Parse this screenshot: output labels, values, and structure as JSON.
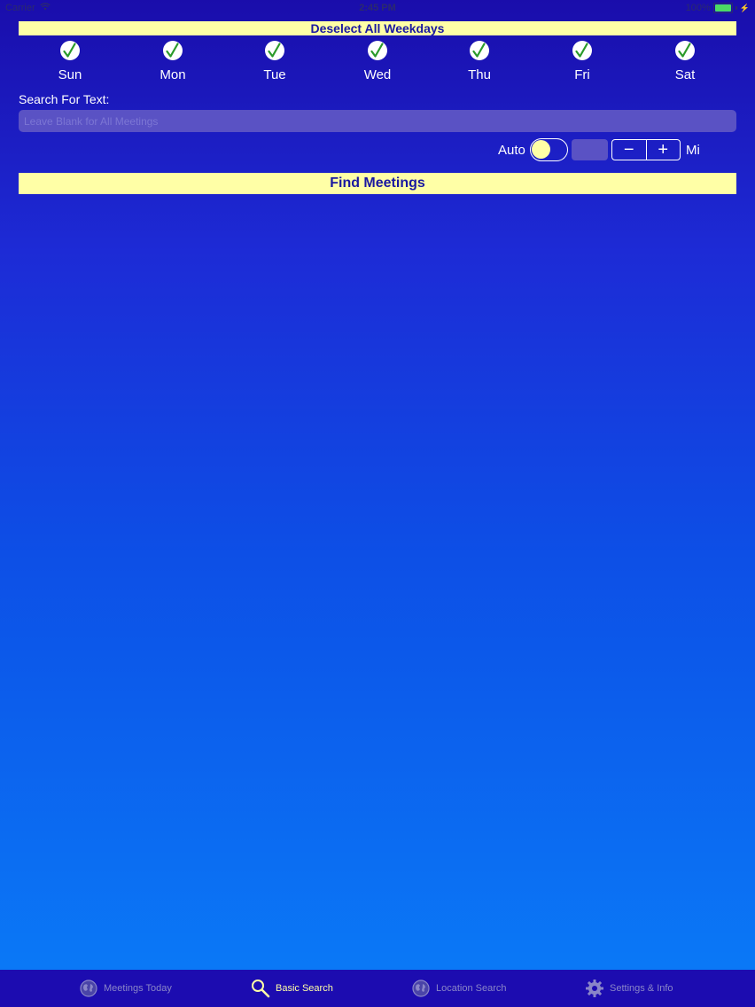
{
  "status_bar": {
    "carrier": "Carrier",
    "time": "2:45 PM",
    "battery": "100%",
    "battery_level": 1.0
  },
  "deselect_button": {
    "label": "Deselect All Weekdays"
  },
  "weekdays": [
    {
      "label": "Sun",
      "checked": true
    },
    {
      "label": "Mon",
      "checked": true
    },
    {
      "label": "Tue",
      "checked": true
    },
    {
      "label": "Wed",
      "checked": true
    },
    {
      "label": "Thu",
      "checked": true
    },
    {
      "label": "Fri",
      "checked": true
    },
    {
      "label": "Sat",
      "checked": true
    }
  ],
  "search": {
    "label": "Search For Text:",
    "placeholder": "Leave Blank for All Meetings",
    "value": ""
  },
  "auto_row": {
    "auto_label": "Auto",
    "auto_on": false,
    "distance_value": "",
    "minus_symbol": "−",
    "plus_symbol": "+",
    "unit_label": "Mi"
  },
  "find_button": {
    "label": "Find Meetings"
  },
  "tab_bar": {
    "tabs": [
      {
        "label": "Meetings Today",
        "icon": "globe-icon",
        "active": false
      },
      {
        "label": "Basic Search",
        "icon": "magnifier-icon",
        "active": true
      },
      {
        "label": "Location Search",
        "icon": "globe-icon",
        "active": false
      },
      {
        "label": "Settings & Info",
        "icon": "gear-icon",
        "active": false
      }
    ]
  },
  "colors": {
    "button_bg": "#ffffa6",
    "button_text": "#1a18a0",
    "check_green": "#2a9a2a",
    "tab_active": "#ffffa6",
    "tab_inactive": "#8a86c8"
  }
}
